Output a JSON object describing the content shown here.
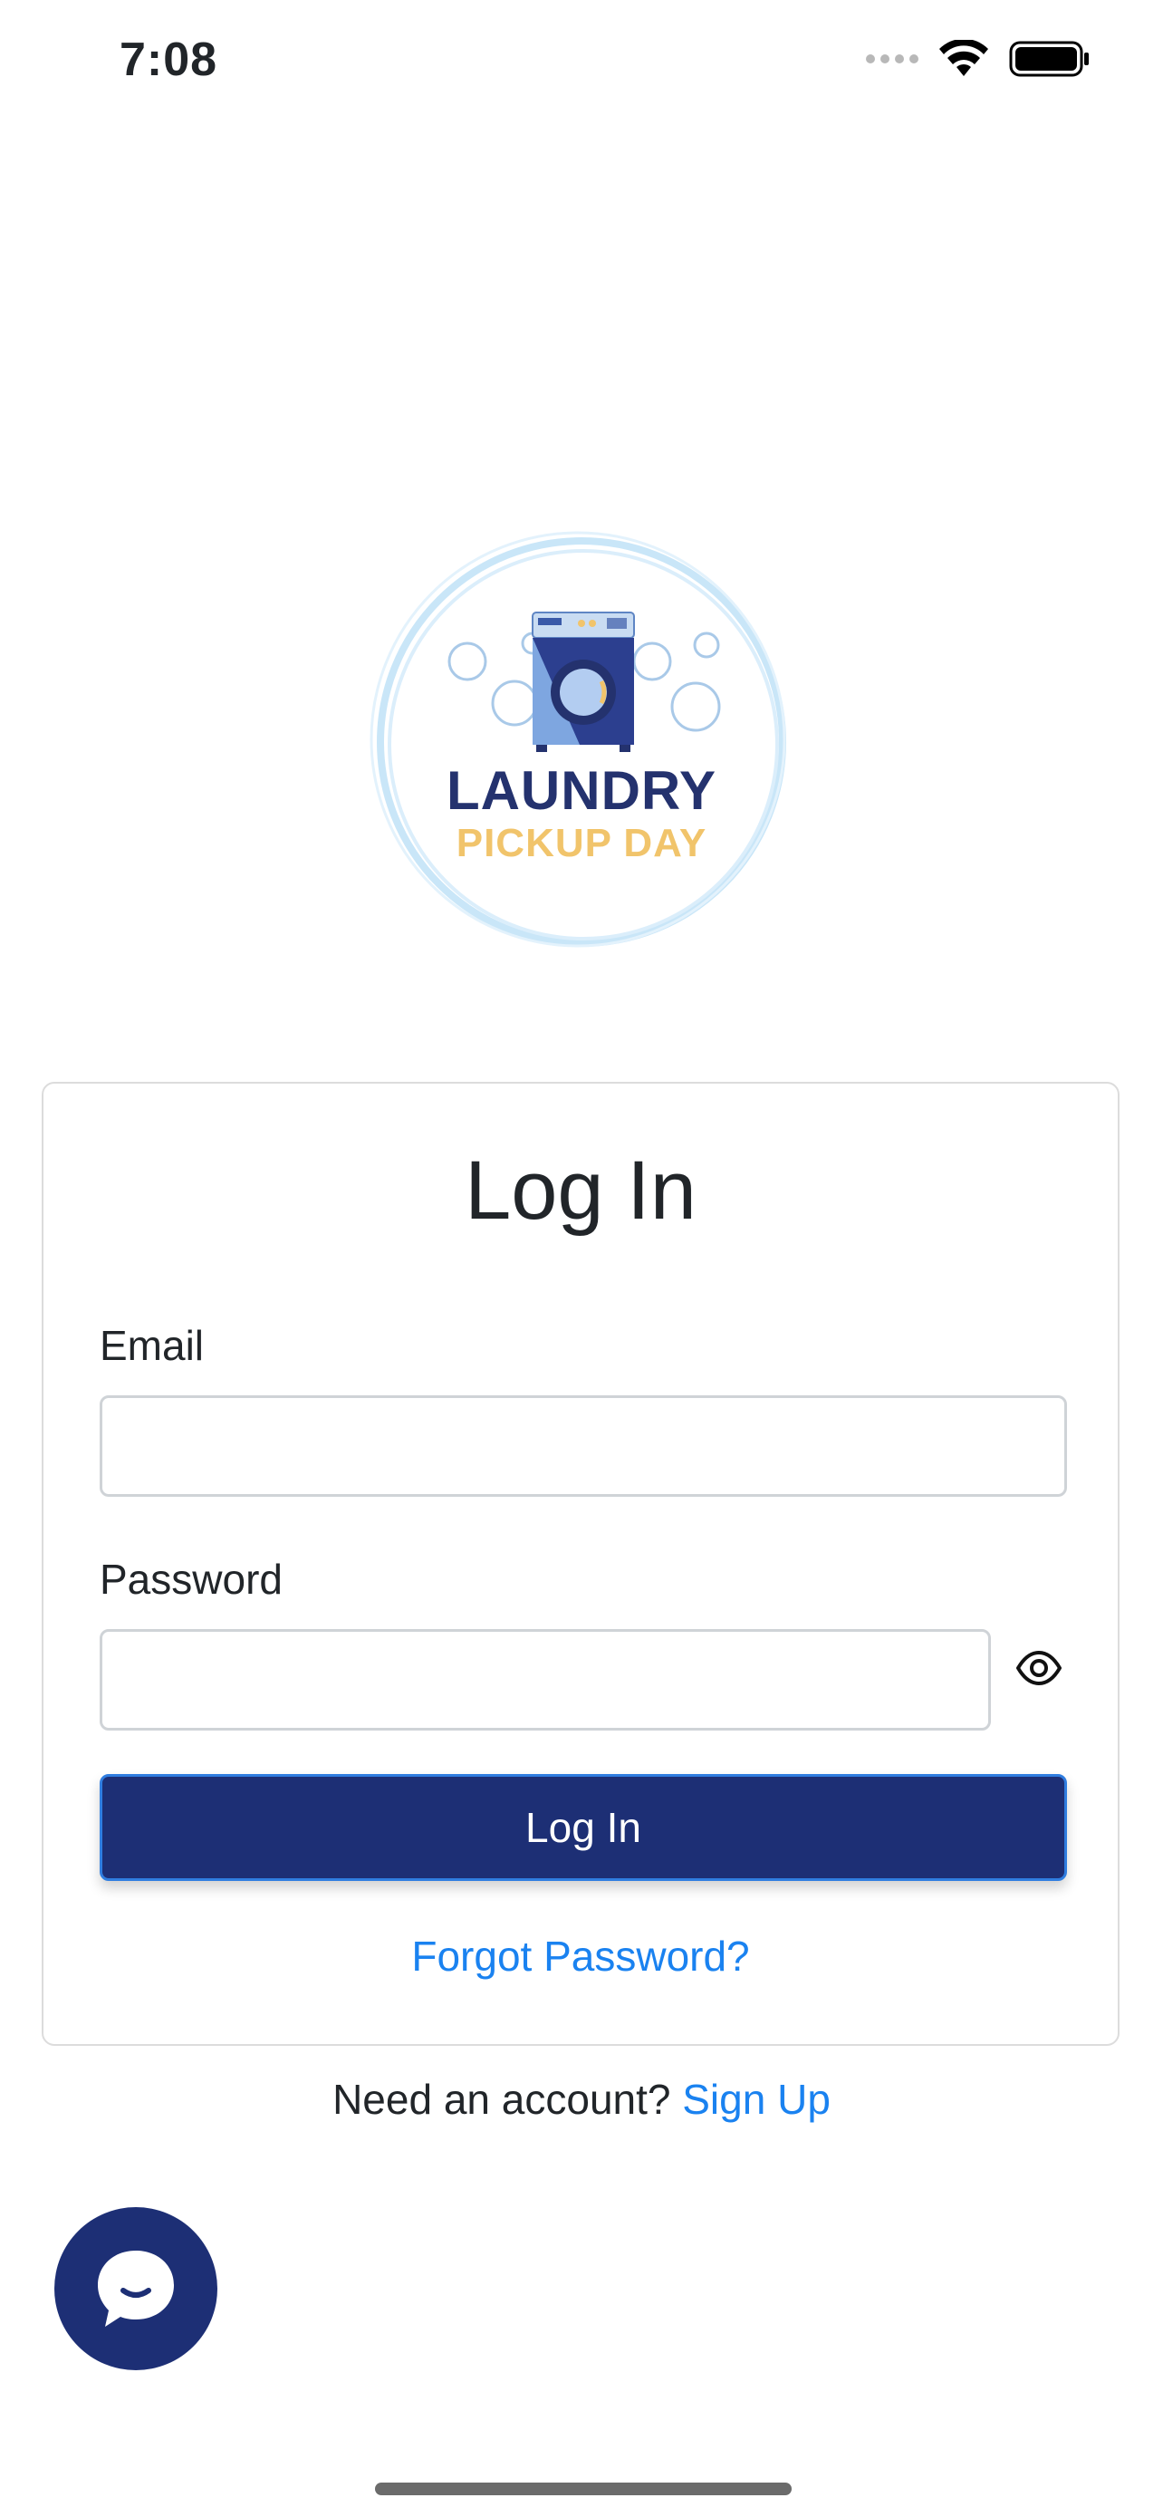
{
  "status_bar": {
    "time": "7:08",
    "icons": [
      "cellular-signal-icon",
      "wifi-icon",
      "battery-icon"
    ]
  },
  "logo": {
    "line1": "LAUNDRY",
    "line2": "PICKUP DAY",
    "colors": {
      "navy": "#24326e",
      "gold": "#f1c46b",
      "light_blue": "#c9e6f8"
    }
  },
  "login_form": {
    "title": "Log In",
    "email_label": "Email",
    "email_value": "",
    "email_placeholder": "",
    "password_label": "Password",
    "password_value": "",
    "password_placeholder": "",
    "submit_label": "Log In",
    "forgot_password": "Forgot Password?"
  },
  "signup": {
    "prompt": "Need an account?",
    "link": "Sign Up"
  },
  "colors": {
    "primary": "#1d2f75",
    "link": "#1a82f0",
    "button_border": "#2f7de0",
    "text": "#212529"
  }
}
